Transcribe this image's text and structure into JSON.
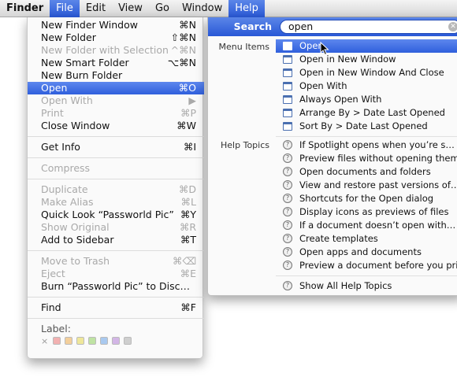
{
  "menubar": {
    "apple_label": "Finder",
    "items": [
      "File",
      "Edit",
      "View",
      "Go",
      "Window",
      "Help"
    ]
  },
  "file_menu": {
    "items": [
      {
        "label": "New Finder Window",
        "shortcut": "⌘N"
      },
      {
        "label": "New Folder",
        "shortcut": "⇧⌘N"
      },
      {
        "label": "New Folder with Selection",
        "shortcut": "^⌘N"
      },
      {
        "label": "New Smart Folder",
        "shortcut": "⌥⌘N"
      },
      {
        "label": "New Burn Folder",
        "shortcut": ""
      },
      {
        "label": "Open",
        "shortcut": "⌘O"
      },
      {
        "label": "Open With",
        "shortcut": "▶"
      },
      {
        "label": "Print",
        "shortcut": "⌘P"
      },
      {
        "label": "Close Window",
        "shortcut": "⌘W"
      },
      {
        "label": "Get Info",
        "shortcut": "⌘I"
      },
      {
        "label": "Compress",
        "shortcut": ""
      },
      {
        "label": "Duplicate",
        "shortcut": "⌘D"
      },
      {
        "label": "Make Alias",
        "shortcut": "⌘L"
      },
      {
        "label": "Quick Look “Passworld Pic”",
        "shortcut": "⌘Y"
      },
      {
        "label": "Show Original",
        "shortcut": "⌘R"
      },
      {
        "label": "Add to Sidebar",
        "shortcut": "⌘T"
      },
      {
        "label": "Move to Trash",
        "shortcut": "⌘⌫"
      },
      {
        "label": "Eject",
        "shortcut": "⌘E"
      },
      {
        "label": "Burn “Passworld Pic” to Disc…",
        "shortcut": ""
      },
      {
        "label": "Find",
        "shortcut": "⌘F"
      },
      {
        "label": "Label:",
        "shortcut": ""
      }
    ],
    "label_x": "×",
    "label_colors": [
      "#f2b1b1",
      "#f3cf9b",
      "#efe79a",
      "#bfe3a3",
      "#a9c9ef",
      "#d3b6e6",
      "#cfcfcf"
    ]
  },
  "help_menu": {
    "search_label": "Search",
    "search_value": "open",
    "clear_glyph": "✕",
    "menu_items_label": "Menu Items",
    "help_topics_label": "Help Topics",
    "menu_items": [
      "Open",
      "Open in New Window",
      "Open in New Window And Close",
      "Open With",
      "Always Open With",
      "Arrange By > Date Last Opened",
      "Sort By > Date Last Opened"
    ],
    "help_topics": [
      "If Spotlight opens when you’re s…",
      "Preview files without opening them",
      "Open documents and folders",
      "View and restore past versions of…",
      "Shortcuts for the Open dialog",
      "Display icons as previews of files",
      "If a document doesn’t open with…",
      "Create templates",
      "Open apps and documents",
      "Preview a document before you print"
    ],
    "show_all": "Show All Help Topics",
    "help_glyph": "?"
  },
  "colors": {
    "highlight": "#3a67e0",
    "pointer": "#3e68d8"
  }
}
